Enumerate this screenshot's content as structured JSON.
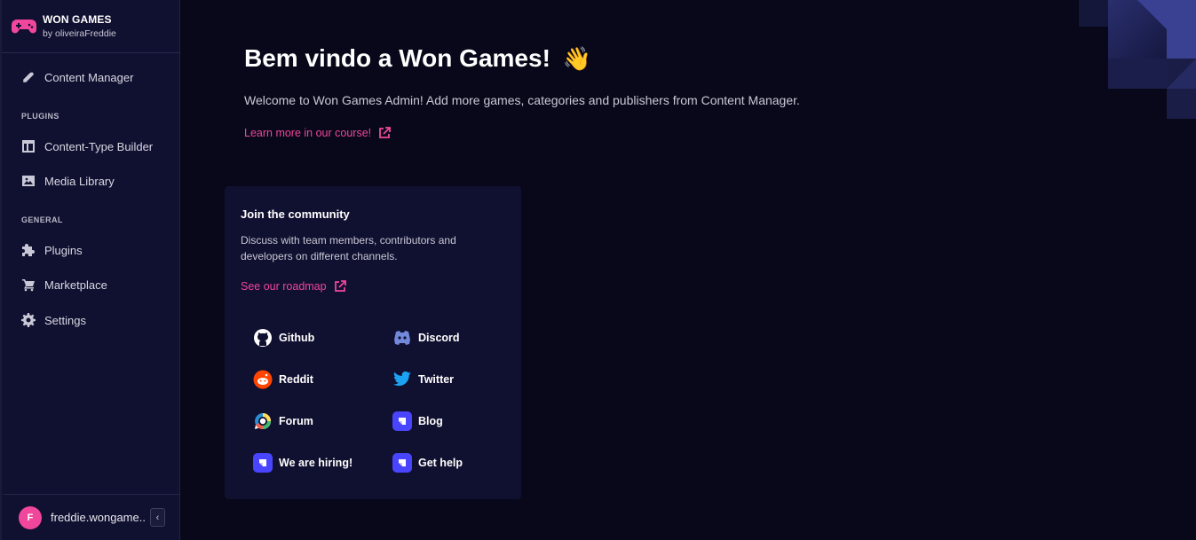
{
  "brand": {
    "name": "WON GAMES",
    "subtitle": "by oliveiraFreddie"
  },
  "sidebar": {
    "content_manager": "Content Manager",
    "plugins_heading": "PLUGINS",
    "content_type_builder": "Content-Type Builder",
    "media_library": "Media Library",
    "general_heading": "GENERAL",
    "plugins": "Plugins",
    "marketplace": "Marketplace",
    "settings": "Settings"
  },
  "user": {
    "initial": "F",
    "name": "freddie.wongame..."
  },
  "main": {
    "title": "Bem vindo a Won Games!",
    "wave": "👋",
    "welcome": "Welcome to Won Games Admin! Add more games, categories and publishers from Content Manager.",
    "learn_link": "Learn more in our course!"
  },
  "community": {
    "title": "Join the community",
    "description": "Discuss with team members, contributors and developers on different channels.",
    "roadmap_link": "See our roadmap",
    "links": {
      "github": "Github",
      "discord": "Discord",
      "reddit": "Reddit",
      "twitter": "Twitter",
      "forum": "Forum",
      "blog": "Blog",
      "hiring": "We are hiring!",
      "help": "Get help"
    }
  },
  "colors": {
    "accent": "#f0469b",
    "strapi": "#4945ff",
    "sidebar": "#101030",
    "background": "#08081a"
  }
}
